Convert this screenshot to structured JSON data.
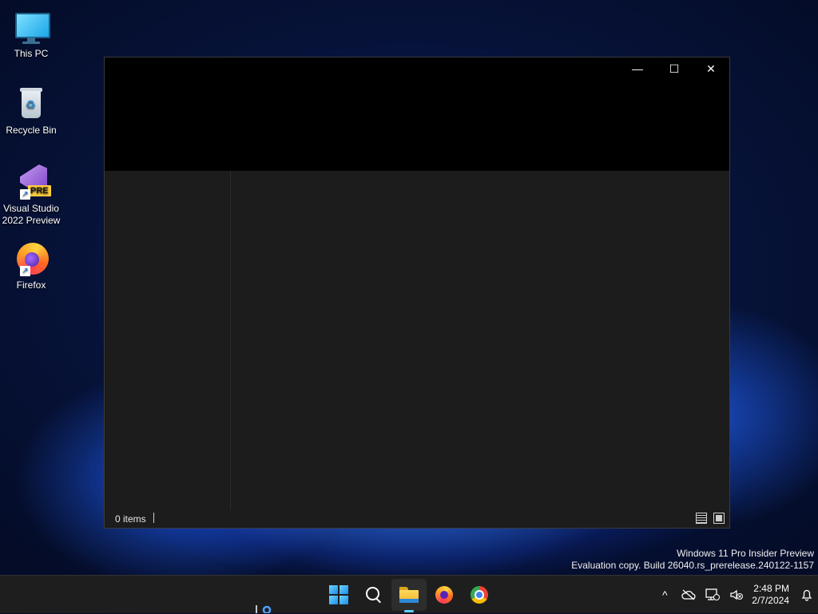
{
  "desktop": {
    "icons": [
      {
        "label": "This PC",
        "icon": "monitor-icon"
      },
      {
        "label": "Recycle Bin",
        "icon": "recycle-bin-icon"
      },
      {
        "label": "Visual Studio\n2022 Preview",
        "icon": "visual-studio-icon",
        "badge": "PRE"
      },
      {
        "label": "Firefox",
        "icon": "firefox-icon"
      }
    ]
  },
  "window": {
    "controls": {
      "minimize": "—",
      "maximize": "☐",
      "close": "✕"
    },
    "status": {
      "item_count": "0 items"
    }
  },
  "watermark": {
    "line1": "Windows 11 Pro Insider Preview",
    "line2": "Evaluation copy. Build 26040.rs_prerelease.240122-1157"
  },
  "taskbar": {
    "pinned": [
      "start-icon",
      "search-icon",
      "file-explorer-icon",
      "firefox-icon",
      "chrome-icon"
    ],
    "active": "file-explorer-icon",
    "tray": {
      "chevron": "^",
      "time": "2:48 PM",
      "date": "2/7/2024"
    }
  },
  "colors": {
    "accent": "#60cdff",
    "taskbar_bg": "#1e1e1e",
    "window_body": "#1c1c1c"
  }
}
